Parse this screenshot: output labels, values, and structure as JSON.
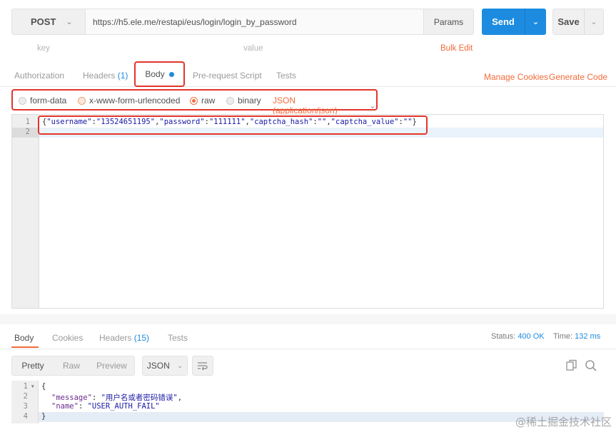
{
  "request": {
    "method": "POST",
    "url": "https://h5.ele.me/restapi/eus/login/login_by_password",
    "params_label": "Params",
    "send_label": "Send",
    "save_label": "Save"
  },
  "kv_row": {
    "key_placeholder": "key",
    "value_placeholder": "value",
    "bulk_edit": "Bulk Edit"
  },
  "request_tabs": {
    "authorization": "Authorization",
    "headers": "Headers",
    "headers_count": "(1)",
    "body": "Body",
    "pre_request": "Pre-request Script",
    "tests": "Tests",
    "manage_cookies": "Manage Cookies",
    "generate_code": "Generate Code"
  },
  "body_options": {
    "form_data": "form-data",
    "urlencoded": "x-www-form-urlencoded",
    "raw": "raw",
    "binary": "binary",
    "selected": "raw",
    "content_type": "JSON (application/json)"
  },
  "editor": {
    "line_numbers": [
      "1",
      "2"
    ],
    "line1_open": "{",
    "line1_tokens": [
      "\"username\"",
      ":",
      "\"13524651195\"",
      ",",
      "\"password\"",
      ":",
      "\"111111\"",
      ",",
      "\"captcha_hash\"",
      ":",
      "\"\"",
      ",",
      "\"captcha_value\"",
      ":",
      "\"\""
    ],
    "line1_close": "}"
  },
  "response_tabs": {
    "body": "Body",
    "cookies": "Cookies",
    "headers": "Headers",
    "headers_count": "(15)",
    "tests": "Tests",
    "status_label": "Status:",
    "status_value": "400 OK",
    "time_label": "Time:",
    "time_value": "132 ms"
  },
  "response_tools": {
    "pretty": "Pretty",
    "raw": "Raw",
    "preview": "Preview",
    "format": "JSON"
  },
  "response_body": {
    "line_numbers": [
      "1",
      "2",
      "3",
      "4"
    ],
    "fold_marker": "▾",
    "open_brace": "{",
    "message_key": "\"message\"",
    "message_value": "\"用户名或者密码错误\"",
    "name_key": "\"name\"",
    "name_value": "\"USER_AUTH_FAIL\"",
    "close_brace": "}"
  },
  "watermark": "@稀土掘金技术社区",
  "colors": {
    "accent_orange": "#f26b3a",
    "send_blue": "#1d8ce0",
    "highlight_red": "#e3352b"
  }
}
